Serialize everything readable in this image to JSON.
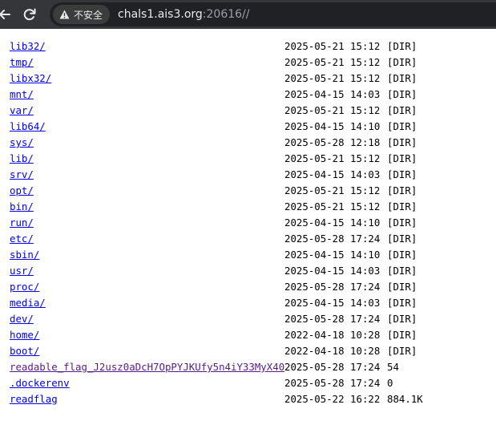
{
  "browser": {
    "security_label": "不安全",
    "url_host": "chals1.ais3.org",
    "url_rest": ":20616//",
    "icons": {
      "back": "arrow-left-icon",
      "reload": "reload-icon",
      "security": "warning-triangle-icon"
    }
  },
  "listing": [
    {
      "name": "lib32/",
      "date": "2025-05-21 15:12",
      "size": "[DIR]"
    },
    {
      "name": "tmp/",
      "date": "2025-05-21 15:12",
      "size": "[DIR]"
    },
    {
      "name": "libx32/",
      "date": "2025-05-21 15:12",
      "size": "[DIR]"
    },
    {
      "name": "mnt/",
      "date": "2025-04-15 14:03",
      "size": "[DIR]"
    },
    {
      "name": "var/",
      "date": "2025-05-21 15:12",
      "size": "[DIR]"
    },
    {
      "name": "lib64/",
      "date": "2025-04-15 14:10",
      "size": "[DIR]"
    },
    {
      "name": "sys/",
      "date": "2025-05-28 12:18",
      "size": "[DIR]"
    },
    {
      "name": "lib/",
      "date": "2025-05-21 15:12",
      "size": "[DIR]"
    },
    {
      "name": "srv/",
      "date": "2025-04-15 14:03",
      "size": "[DIR]"
    },
    {
      "name": "opt/",
      "date": "2025-05-21 15:12",
      "size": "[DIR]"
    },
    {
      "name": "bin/",
      "date": "2025-05-21 15:12",
      "size": "[DIR]"
    },
    {
      "name": "run/",
      "date": "2025-04-15 14:10",
      "size": "[DIR]"
    },
    {
      "name": "etc/",
      "date": "2025-05-28 17:24",
      "size": "[DIR]"
    },
    {
      "name": "sbin/",
      "date": "2025-04-15 14:10",
      "size": "[DIR]"
    },
    {
      "name": "usr/",
      "date": "2025-04-15 14:03",
      "size": "[DIR]"
    },
    {
      "name": "proc/",
      "date": "2025-05-28 17:24",
      "size": "[DIR]"
    },
    {
      "name": "media/",
      "date": "2025-04-15 14:03",
      "size": "[DIR]"
    },
    {
      "name": "dev/",
      "date": "2025-05-28 17:24",
      "size": "[DIR]"
    },
    {
      "name": "home/",
      "date": "2022-04-18 10:28",
      "size": "[DIR]"
    },
    {
      "name": "boot/",
      "date": "2022-04-18 10:28",
      "size": "[DIR]"
    },
    {
      "name": "readable_flag_J2usz0aDcH7OpPYJKUfy5n4iY33MyX40",
      "date": "2025-05-28 17:24",
      "size": "54",
      "visited": true
    },
    {
      "name": ".dockerenv",
      "date": "2025-05-28 17:24",
      "size": "0"
    },
    {
      "name": "readflag",
      "date": "2025-05-22 16:22",
      "size": "884.1K"
    }
  ],
  "colors": {
    "link": "#0000ee",
    "visited_link": "#551a8b",
    "toolbar": "#35363a",
    "omnibox": "#202124"
  }
}
